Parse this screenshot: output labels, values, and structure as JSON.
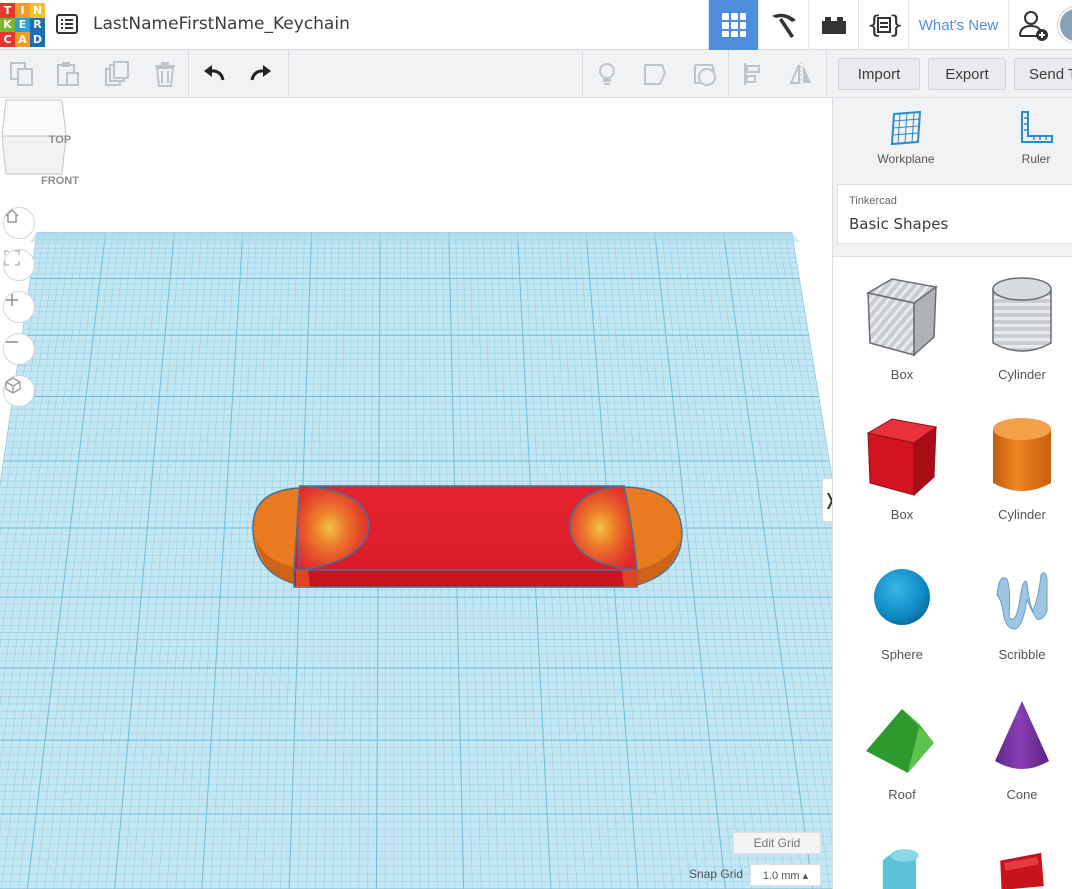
{
  "app": {
    "logo_letters": [
      "T",
      "I",
      "N",
      "K",
      "E",
      "R",
      "C",
      "A",
      "D"
    ],
    "logo_colors": [
      "#e5372e",
      "#f39c26",
      "#f7c21f",
      "#76b82a",
      "#27a2d8",
      "#1b6fb5",
      "#e5372e",
      "#f39c26",
      "#1b6fb5"
    ]
  },
  "header": {
    "title": "LastNameFirstName_Keychain",
    "whats_new": "What's New"
  },
  "toolbar": {
    "import": "Import",
    "export": "Export",
    "send": "Send T"
  },
  "viewcube": {
    "top": "TOP",
    "front": "FRONT"
  },
  "grid": {
    "edit_grid": "Edit Grid",
    "snap_label": "Snap Grid",
    "snap_value": "1.0 mm ▴"
  },
  "panel": {
    "workplane": "Workplane",
    "ruler": "Ruler",
    "library_provider": "Tinkercad",
    "library_name": "Basic Shapes",
    "collapse": "❭",
    "shapes": [
      {
        "label": "Box",
        "icon": "box-hole-icon"
      },
      {
        "label": "Cylinder",
        "icon": "cylinder-hole-icon"
      },
      {
        "label": "Box",
        "icon": "box-solid-icon"
      },
      {
        "label": "Cylinder",
        "icon": "cylinder-solid-icon"
      },
      {
        "label": "Sphere",
        "icon": "sphere-icon"
      },
      {
        "label": "Scribble",
        "icon": "scribble-icon"
      },
      {
        "label": "Roof",
        "icon": "roof-icon"
      },
      {
        "label": "Cone",
        "icon": "cone-icon"
      }
    ]
  },
  "colors": {
    "accent": "#4f8edc",
    "grid_fill": "#c4e7f3",
    "grid_line": "#8fcde3",
    "keychain_red": "#dd1f2b",
    "keychain_orange": "#ec7d24"
  }
}
